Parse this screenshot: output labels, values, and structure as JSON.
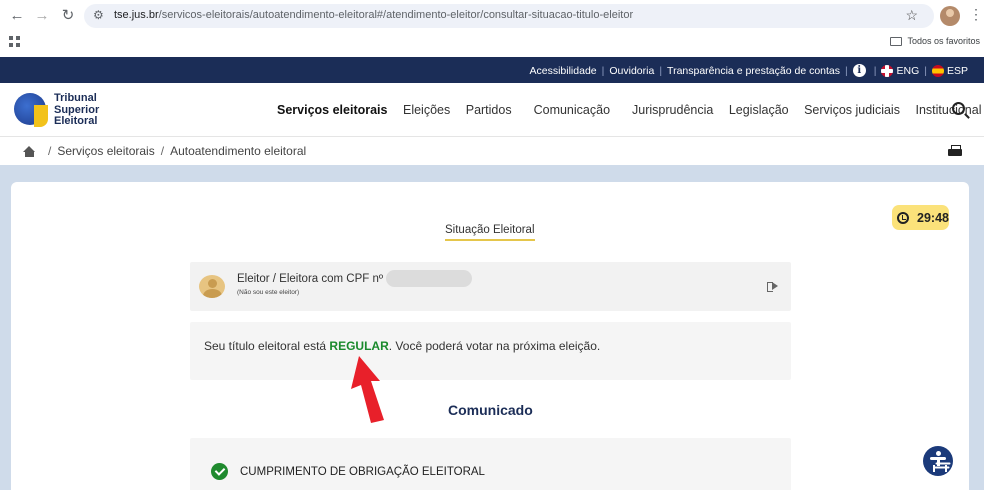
{
  "browser": {
    "url_host": "tse.jus.br",
    "url_path": "/servicos-eleitorais/autoatendimento-eleitoral#/atendimento-eleitor/consultar-situacao-titulo-eleitor",
    "bookmarks_label": "Todos os favoritos",
    "back_glyph": "←",
    "forward_glyph": "→",
    "reload_glyph": "↻",
    "star_glyph": "☆",
    "menu_glyph": "⋮",
    "tune_glyph": "⚙"
  },
  "utility_bar": {
    "items": [
      "Acessibilidade",
      "Ouvidoria",
      "Transparência e prestação de contas"
    ],
    "info_glyph": "i",
    "lang_en": "ENG",
    "lang_es": "ESP"
  },
  "header": {
    "logo_line1": "Tribunal",
    "logo_line2": "Superior",
    "logo_line3": "Eleitoral",
    "nav": [
      "Serviços eleitorais",
      "Eleições",
      "Partidos",
      "Comunicação",
      "Jurisprudência",
      "Legislação",
      "Serviços judiciais",
      "Institucional"
    ]
  },
  "breadcrumb": {
    "items": [
      "Serviços eleitorais",
      "Autoatendimento eleitoral"
    ]
  },
  "main": {
    "timer": "29:48",
    "title": "Situação Eleitoral",
    "voter_label": "Eleitor / Eleitora com CPF nº",
    "not_me": "(Não sou este eleitor)",
    "status_prefix": "Seu título eleitoral está ",
    "status_value": "REGULAR",
    "status_suffix": ". Você poderá votar na próxima eleição.",
    "comunicado": "Comunicado",
    "obligation": "CUMPRIMENTO DE OBRIGAÇÃO ELEITORAL"
  },
  "colors": {
    "navy": "#1b2d57",
    "regular_green": "#1a8a2c",
    "timer_yellow": "#fbe27a",
    "annotation_arrow": "#e8202a"
  }
}
